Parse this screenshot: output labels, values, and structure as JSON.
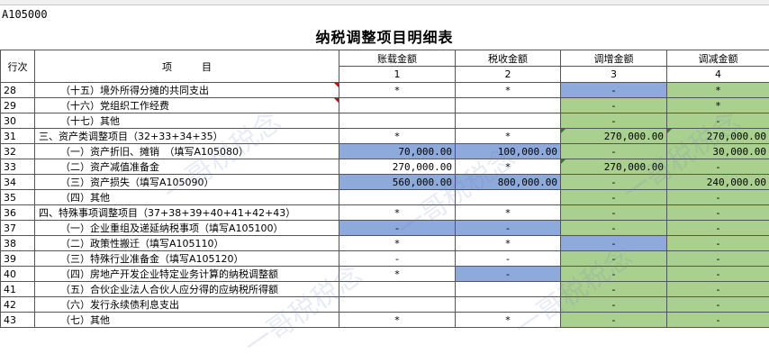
{
  "sheet": {
    "code": "A105000",
    "title": "纳税调整项目明细表"
  },
  "header": {
    "row_label": "行次",
    "item_label": "项　　　目",
    "cols": [
      "账载金额",
      "税收金额",
      "调增金额",
      "调减金额"
    ],
    "nums": [
      "1",
      "2",
      "3",
      "4"
    ]
  },
  "rows": [
    {
      "no": "28",
      "item": "（十五）境外所得分摊的共同支出",
      "c1": "*",
      "c2": "*",
      "c3": "-",
      "c4": "*"
    },
    {
      "no": "29",
      "item": "（十六）党组织工作经费",
      "c1": "",
      "c2": "",
      "c3": "-",
      "c4": "*"
    },
    {
      "no": "30",
      "item": "（十七）其他",
      "c1": "",
      "c2": "",
      "c3": "-",
      "c4": "-"
    },
    {
      "no": "31",
      "item": "三、资产类调整项目（32+33+34+35）",
      "c1": "*",
      "c2": "*",
      "c3": "270,000.00",
      "c4": "270,000.00"
    },
    {
      "no": "32",
      "item": "（一）资产折旧、摊销　（填写A105080）",
      "c1": "70,000.00",
      "c2": "100,000.00",
      "c3": "-",
      "c4": "30,000.00"
    },
    {
      "no": "33",
      "item": "（二）资产减值准备金",
      "c1": "270,000.00",
      "c2": "*",
      "c3": "270,000.00",
      "c4": "-"
    },
    {
      "no": "34",
      "item": "（三）资产损失（填写A105090）",
      "c1": "560,000.00",
      "c2": "800,000.00",
      "c3": "-",
      "c4": "240,000.00"
    },
    {
      "no": "35",
      "item": "（四）其他",
      "c1": "",
      "c2": "",
      "c3": "-",
      "c4": "-"
    },
    {
      "no": "36",
      "item": "四、特殊事项调整项目（37+38+39+40+41+42+43）",
      "c1": "*",
      "c2": "*",
      "c3": "-",
      "c4": "-"
    },
    {
      "no": "37",
      "item": "（一）企业重组及递延纳税事项（填写A105100）",
      "c1": "-",
      "c2": "-",
      "c3": "-",
      "c4": "-"
    },
    {
      "no": "38",
      "item": "（二）政策性搬迁（填写A105110）",
      "c1": "*",
      "c2": "*",
      "c3": "-",
      "c4": "-"
    },
    {
      "no": "39",
      "item": "（三）特殊行业准备金（填写A105120）",
      "c1": "-",
      "c2": "-",
      "c3": "-",
      "c4": "-"
    },
    {
      "no": "40",
      "item": "（四）房地产开发企业特定业务计算的纳税调整额",
      "c1": "*",
      "c2": "-",
      "c3": "-",
      "c4": "-"
    },
    {
      "no": "41",
      "item": "（五）合伙企业法人合伙人应分得的应纳税所得额",
      "c1": "",
      "c2": "",
      "c3": "-",
      "c4": "-"
    },
    {
      "no": "42",
      "item": "（六）发行永续债利息支出",
      "c1": "",
      "c2": "",
      "c3": "-",
      "c4": "-"
    },
    {
      "no": "43",
      "item": "（七）其他",
      "c1": "*",
      "c2": "*",
      "c3": "-",
      "c4": "-"
    }
  ],
  "watermark": "一哥税税念",
  "colors": {
    "blue": "#8ea9db",
    "green": "#a9d08e",
    "border": "#555555"
  }
}
